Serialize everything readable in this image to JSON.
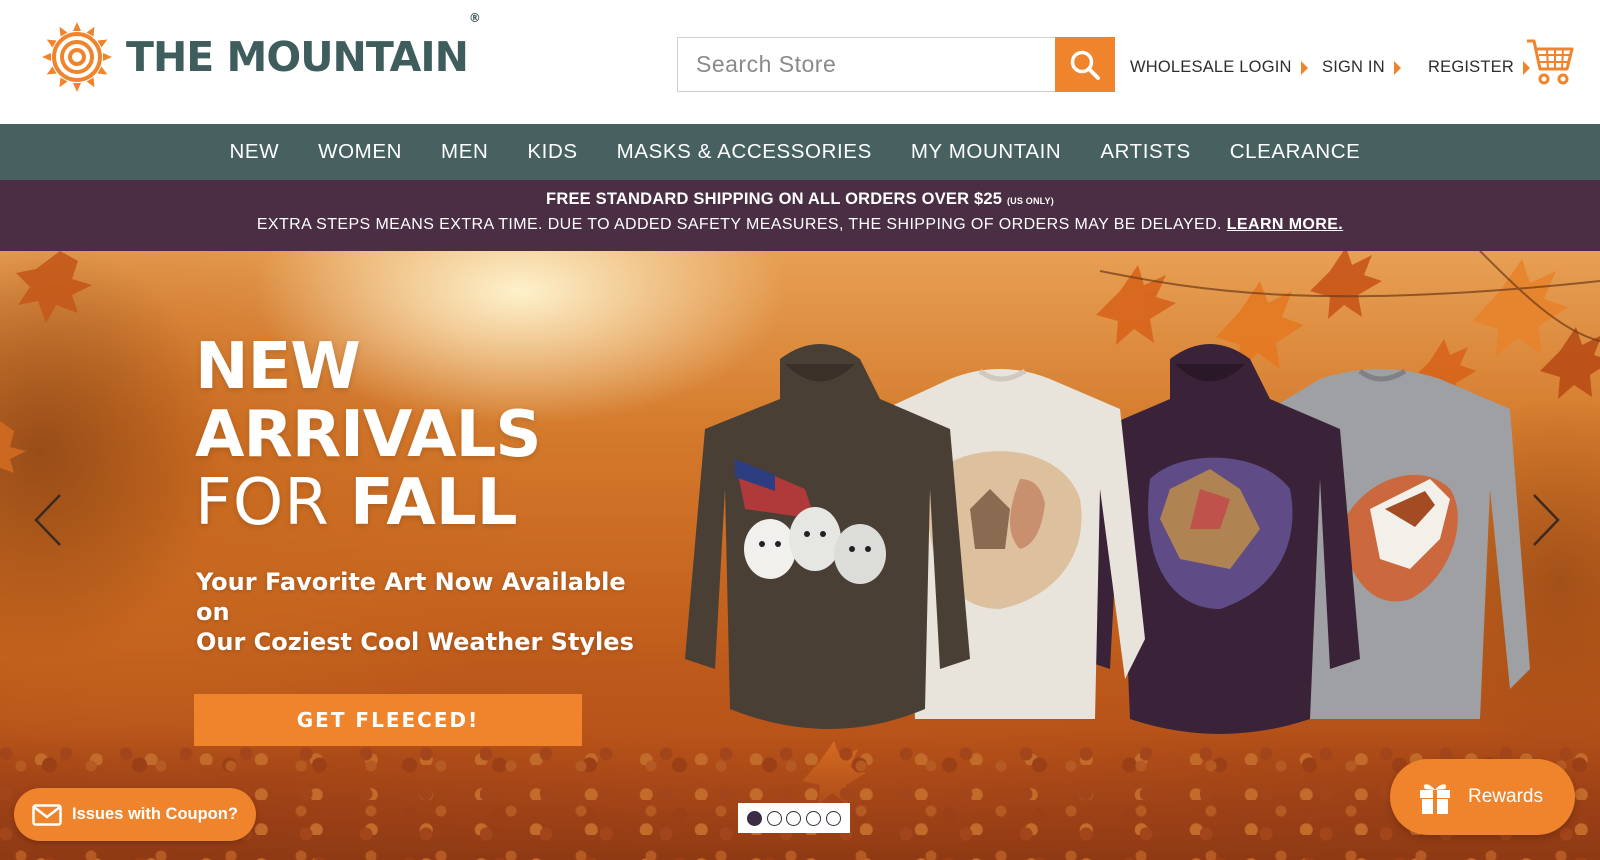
{
  "brand": {
    "name": "THE MOUNTAIN",
    "registered": "®",
    "color": "#3f5d5d",
    "accent": "#f0842c"
  },
  "search": {
    "placeholder": "Search Store",
    "value": "",
    "icon": "search-icon"
  },
  "top_links": [
    {
      "label": "WHOLESALE LOGIN"
    },
    {
      "label": "SIGN IN"
    },
    {
      "label": "REGISTER"
    }
  ],
  "cart": {
    "icon": "cart-icon"
  },
  "nav": {
    "items": [
      {
        "label": "NEW"
      },
      {
        "label": "WOMEN"
      },
      {
        "label": "MEN"
      },
      {
        "label": "KIDS"
      },
      {
        "label": "MASKS & ACCESSORIES"
      },
      {
        "label": "MY MOUNTAIN"
      },
      {
        "label": "ARTISTS"
      },
      {
        "label": "CLEARANCE"
      }
    ],
    "bg_color": "#466160"
  },
  "promo": {
    "line1": "FREE STANDARD SHIPPING ON ALL ORDERS OVER $25",
    "line1_note": "(US ONLY)",
    "line2": "EXTRA STEPS MEANS EXTRA TIME. DUE TO ADDED SAFETY MEASURES, THE SHIPPING OF ORDERS MAY BE DELAYED.",
    "link": "LEARN MORE.",
    "bg_color": "#4a2e43"
  },
  "hero": {
    "title_line1": "NEW",
    "title_line2": "ARRIVALS",
    "title_line3_light": "FOR",
    "title_line3_bold": "FALL",
    "subtitle_line1": "Your Favorite Art Now Available on",
    "subtitle_line2": "Our Coziest Cool Weather Styles",
    "cta": "GET FLEECED!",
    "slides_total": 5,
    "active_slide": 1
  },
  "widgets": {
    "coupon": "Issues with Coupon?",
    "rewards": "Rewards"
  }
}
